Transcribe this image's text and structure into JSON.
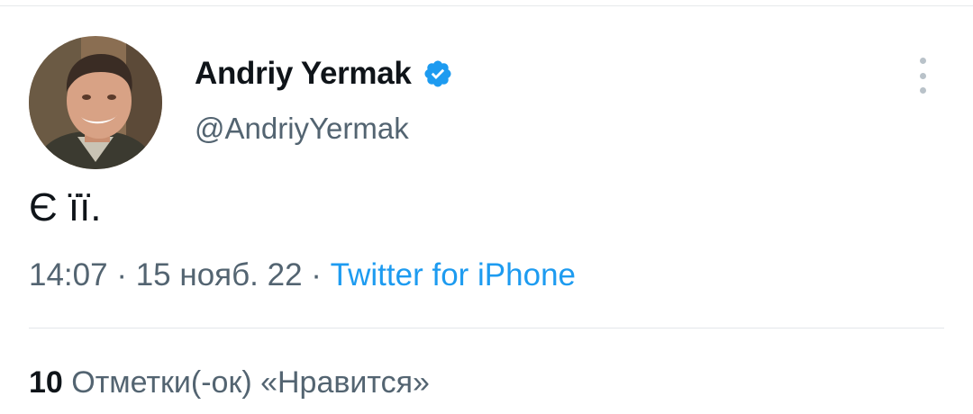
{
  "tweet": {
    "author": {
      "display_name": "Andriy Yermak",
      "handle": "@AndriyYermak",
      "verified": true,
      "avatar": "author-photo"
    },
    "text": "Є її.",
    "time": "14:07",
    "date": "15 нояб. 22",
    "separator": "·",
    "source": "Twitter for iPhone",
    "likes": {
      "count": "10",
      "label": "Отметки(-ок) «Нравится»"
    }
  },
  "icons": {
    "verified": "verified-badge-icon",
    "more": "more-options-icon"
  },
  "colors": {
    "accent": "#1d9bf0",
    "text_primary": "#0f1419",
    "text_secondary": "#536471",
    "divider": "#e3e7ea"
  }
}
